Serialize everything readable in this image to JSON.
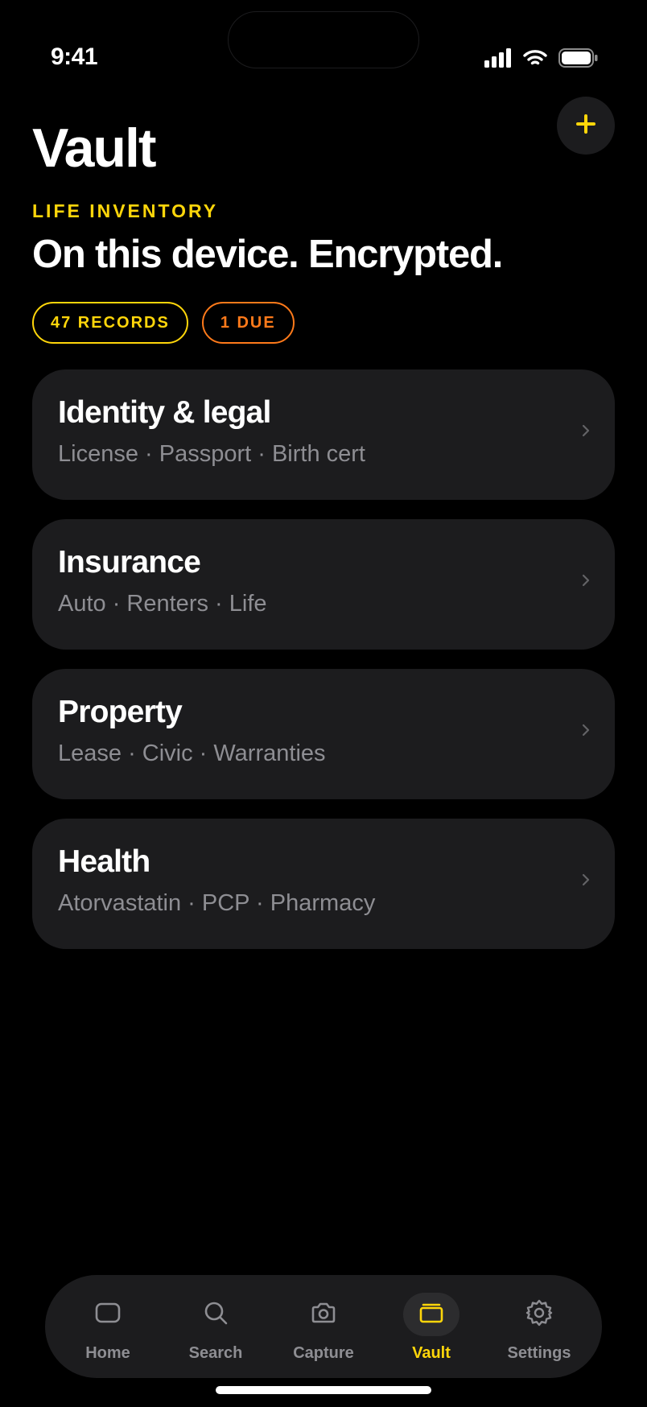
{
  "status_bar": {
    "time": "9:41",
    "icons": [
      "cellular-signal-icon",
      "wifi-icon",
      "battery-icon"
    ]
  },
  "header": {
    "title": "Vault",
    "eyebrow": "LIFE INVENTORY",
    "headline": "On this device. Encrypted.",
    "add_icon": "plus-icon"
  },
  "badges": {
    "records": "47 RECORDS",
    "due": "1 DUE"
  },
  "categories": [
    {
      "title": "Identity & legal",
      "subtitle": "License · Passport · Birth cert"
    },
    {
      "title": "Insurance",
      "subtitle": "Auto · Renters · Life"
    },
    {
      "title": "Property",
      "subtitle": "Lease · Civic · Warranties"
    },
    {
      "title": "Health",
      "subtitle": "Atorvastatin · PCP · Pharmacy"
    }
  ],
  "tab_bar": {
    "active": "Vault",
    "tabs": [
      {
        "label": "Home",
        "icon": "home-icon"
      },
      {
        "label": "Search",
        "icon": "search-icon"
      },
      {
        "label": "Capture",
        "icon": "camera-icon"
      },
      {
        "label": "Vault",
        "icon": "vault-icon"
      },
      {
        "label": "Settings",
        "icon": "gear-icon"
      }
    ]
  },
  "colors": {
    "accent": "#ffd60a",
    "due": "#ff7a1a",
    "background": "#000000",
    "card": "#1c1c1e",
    "secondary_text": "#8e8e93"
  }
}
